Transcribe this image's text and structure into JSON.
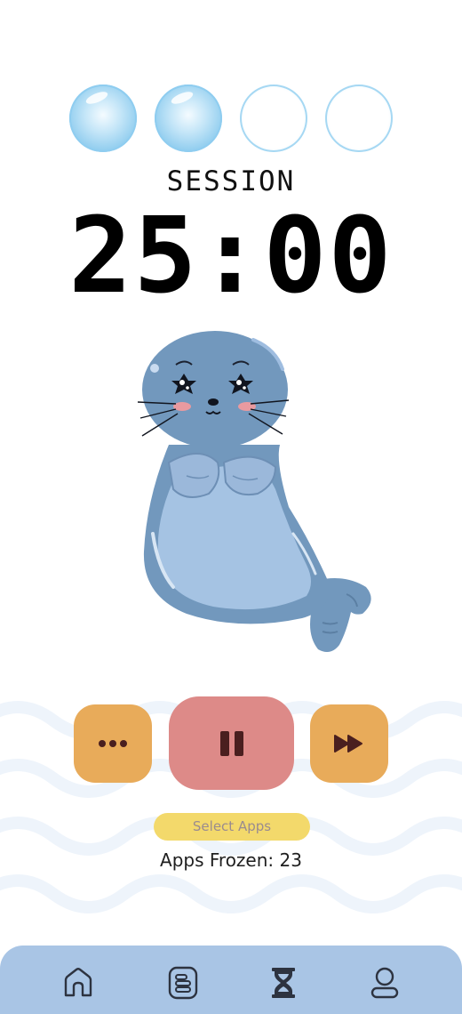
{
  "session": {
    "label": "SESSION",
    "timer": "25:00",
    "bubbles": [
      {
        "state": "filled"
      },
      {
        "state": "filled"
      },
      {
        "state": "empty"
      },
      {
        "state": "empty"
      }
    ]
  },
  "controls": {
    "more_icon": "more-dots-icon",
    "pause_icon": "pause-icon",
    "skip_icon": "fast-forward-icon"
  },
  "apps": {
    "select_label": "Select Apps",
    "frozen_text": "Apps Frozen: 23"
  },
  "nav": {
    "items": [
      {
        "icon": "home-icon"
      },
      {
        "icon": "notes-icon"
      },
      {
        "icon": "hourglass-icon",
        "active": true
      },
      {
        "icon": "profile-icon"
      }
    ]
  },
  "colors": {
    "accent_orange": "#e8ab5a",
    "pause_red": "#dd8a88",
    "select_yellow": "#f3d96b",
    "nav_blue": "#a9c5e5",
    "seal_body": "#7298bd",
    "seal_belly": "#a5c3e3"
  }
}
